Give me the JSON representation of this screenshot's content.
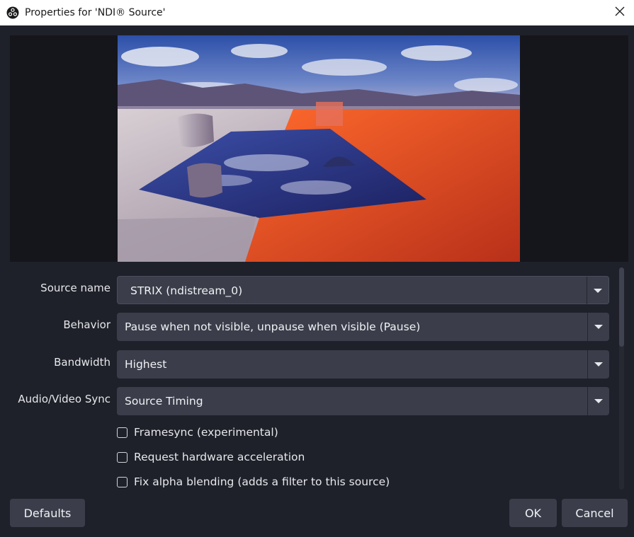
{
  "window": {
    "title": "Properties for 'NDI® Source'",
    "app_icon": "obs-logo-icon",
    "close_icon": "close-icon"
  },
  "preview": {
    "image": "3d-scene-preview"
  },
  "properties": {
    "source_name": {
      "label": "Source name",
      "value": "STRIX (ndistream_0)"
    },
    "behavior": {
      "label": "Behavior",
      "value": "Pause when not visible, unpause when visible (Pause)"
    },
    "bandwidth": {
      "label": "Bandwidth",
      "value": "Highest"
    },
    "av_sync": {
      "label": "Audio/Video Sync",
      "value": "Source Timing"
    },
    "checkboxes": [
      {
        "label": "Framesync (experimental)",
        "checked": false
      },
      {
        "label": "Request hardware acceleration",
        "checked": false
      },
      {
        "label": "Fix alpha blending (adds a filter to this source)",
        "checked": false
      }
    ]
  },
  "buttons": {
    "defaults": "Defaults",
    "ok": "OK",
    "cancel": "Cancel"
  },
  "colors": {
    "background": "#1f212a",
    "control": "#3b3e4a",
    "titlebar": "#ffffff"
  }
}
